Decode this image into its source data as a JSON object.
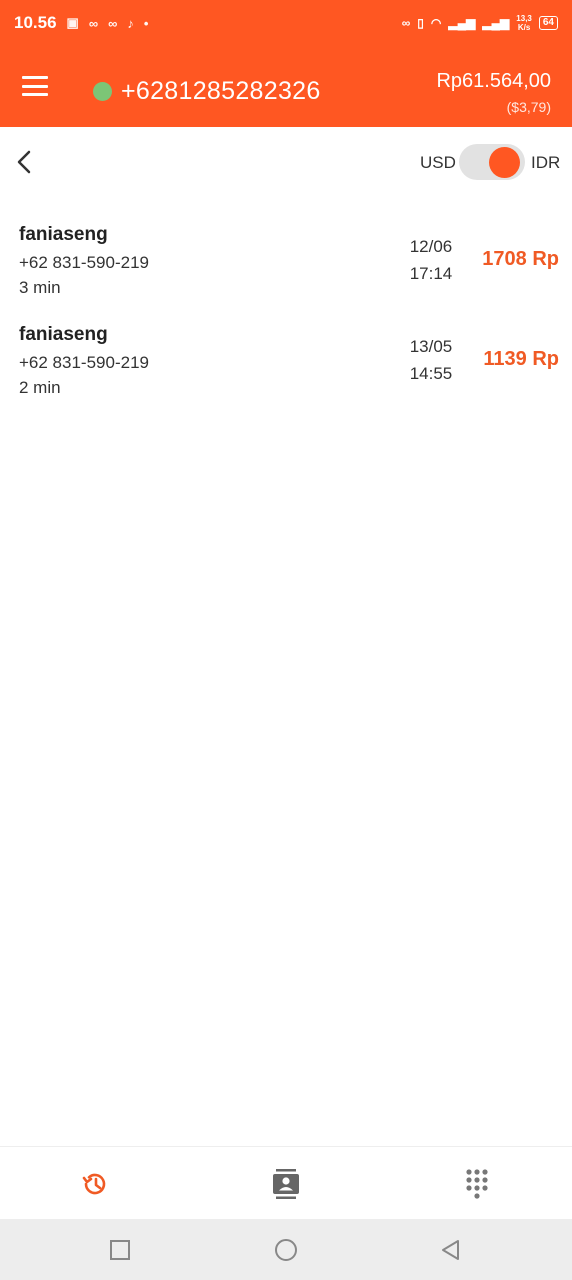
{
  "status_bar": {
    "time": "10.56",
    "speed": "13,3",
    "speed_unit": "K/s",
    "battery": "64"
  },
  "header": {
    "phone_number": "+6281285282326",
    "balance": "Rp61.564,00",
    "balance_usd": "($3,79)",
    "colors": {
      "brand": "#FF5722",
      "online": "#7CC576"
    }
  },
  "currency_toggle": {
    "left_label": "USD",
    "right_label": "IDR",
    "selected": "IDR"
  },
  "calls": [
    {
      "name": "faniaseng",
      "number": "+62 831-590-219",
      "duration": "3 min",
      "date": "12/06",
      "time": "17:14",
      "cost": "1708 Rp"
    },
    {
      "name": "faniaseng",
      "number": "+62 831-590-219",
      "duration": "2 min",
      "date": "13/05",
      "time": "14:55",
      "cost": "1139 Rp"
    }
  ],
  "bottom_nav": {
    "items": [
      {
        "icon": "history-icon",
        "active": true
      },
      {
        "icon": "contacts-icon",
        "active": false
      },
      {
        "icon": "dialpad-icon",
        "active": false
      }
    ]
  },
  "system_nav": {
    "items": [
      "recents-icon",
      "home-icon",
      "back-icon"
    ]
  }
}
